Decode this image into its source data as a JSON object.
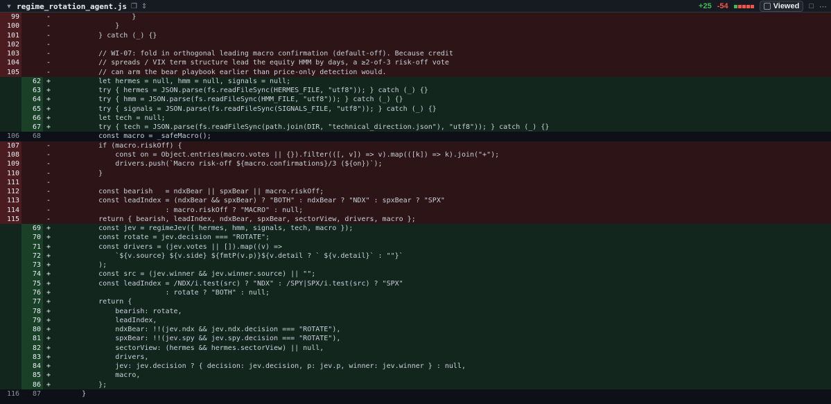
{
  "file": {
    "name": "regime_rotation_agent.js",
    "additions": "+25",
    "deletions": "-54",
    "viewed_label": "Viewed",
    "colors": {
      "add": "#3fb950",
      "del": "#f85149",
      "bg": "#0d1117"
    }
  },
  "lines": [
    {
      "t": "del",
      "o": "99",
      "n": "",
      "m": "-",
      "c": "                }"
    },
    {
      "t": "del",
      "o": "100",
      "n": "",
      "m": "-",
      "c": "            }"
    },
    {
      "t": "del",
      "o": "101",
      "n": "",
      "m": "-",
      "c": "        } catch (_) {}"
    },
    {
      "t": "del",
      "o": "102",
      "n": "",
      "m": "-",
      "c": ""
    },
    {
      "t": "del",
      "o": "103",
      "n": "",
      "m": "-",
      "c": "        // WI-07: fold in orthogonal leading macro confirmation (default-off). Because credit"
    },
    {
      "t": "del",
      "o": "104",
      "n": "",
      "m": "-",
      "c": "        // spreads / VIX term structure lead the equity HMM by days, a ≥2-of-3 risk-off vote"
    },
    {
      "t": "del",
      "o": "105",
      "n": "",
      "m": "-",
      "c": "        // can arm the bear playbook earlier than price-only detection would."
    },
    {
      "t": "add",
      "o": "",
      "n": "62",
      "m": "+",
      "c": "        let hermes = null, hmm = null, signals = null;"
    },
    {
      "t": "add",
      "o": "",
      "n": "63",
      "m": "+",
      "c": "        try { hermes = JSON.parse(fs.readFileSync(HERMES_FILE, \"utf8\")); } catch (_) {}"
    },
    {
      "t": "add",
      "o": "",
      "n": "64",
      "m": "+",
      "c": "        try { hmm = JSON.parse(fs.readFileSync(HMM_FILE, \"utf8\")); } catch (_) {}"
    },
    {
      "t": "add",
      "o": "",
      "n": "65",
      "m": "+",
      "c": "        try { signals = JSON.parse(fs.readFileSync(SIGNALS_FILE, \"utf8\")); } catch (_) {}"
    },
    {
      "t": "add",
      "o": "",
      "n": "66",
      "m": "+",
      "c": "        let tech = null;"
    },
    {
      "t": "add",
      "o": "",
      "n": "67",
      "m": "+",
      "c": "        try { tech = JSON.parse(fs.readFileSync(path.join(DIR, \"technical_direction.json\"), \"utf8\")); } catch (_) {}"
    },
    {
      "t": "ctx",
      "o": "106",
      "n": "68",
      "m": "",
      "c": "        const macro = _safeMacro();"
    },
    {
      "t": "del",
      "o": "107",
      "n": "",
      "m": "-",
      "c": "        if (macro.riskOff) {"
    },
    {
      "t": "del",
      "o": "108",
      "n": "",
      "m": "-",
      "c": "            const on = Object.entries(macro.votes || {}).filter(([, v]) => v).map(([k]) => k).join(\"+\");"
    },
    {
      "t": "del",
      "o": "109",
      "n": "",
      "m": "-",
      "c": "            drivers.push(`Macro risk-off ${macro.confirmations}/3 (${on})`);"
    },
    {
      "t": "del",
      "o": "110",
      "n": "",
      "m": "-",
      "c": "        }"
    },
    {
      "t": "del",
      "o": "111",
      "n": "",
      "m": "-",
      "c": ""
    },
    {
      "t": "del",
      "o": "112",
      "n": "",
      "m": "-",
      "c": "        const bearish   = ndxBear || spxBear || macro.riskOff;"
    },
    {
      "t": "del",
      "o": "113",
      "n": "",
      "m": "-",
      "c": "        const leadIndex = (ndxBear && spxBear) ? \"BOTH\" : ndxBear ? \"NDX\" : spxBear ? \"SPX\""
    },
    {
      "t": "del",
      "o": "114",
      "n": "",
      "m": "-",
      "c": "                        : macro.riskOff ? \"MACRO\" : null;"
    },
    {
      "t": "del",
      "o": "115",
      "n": "",
      "m": "-",
      "c": "        return { bearish, leadIndex, ndxBear, spxBear, sectorView, drivers, macro };"
    },
    {
      "t": "add",
      "o": "",
      "n": "69",
      "m": "+",
      "c": "        const jev = regimeJev({ hermes, hmm, signals, tech, macro });"
    },
    {
      "t": "add",
      "o": "",
      "n": "70",
      "m": "+",
      "c": "        const rotate = jev.decision === \"ROTATE\";"
    },
    {
      "t": "add",
      "o": "",
      "n": "71",
      "m": "+",
      "c": "        const drivers = (jev.votes || []).map((v) =>"
    },
    {
      "t": "add",
      "o": "",
      "n": "72",
      "m": "+",
      "c": "            `${v.source} ${v.side} ${fmtP(v.p)}${v.detail ? ` ${v.detail}` : \"\"}`"
    },
    {
      "t": "add",
      "o": "",
      "n": "73",
      "m": "+",
      "c": "        );"
    },
    {
      "t": "add",
      "o": "",
      "n": "74",
      "m": "+",
      "c": "        const src = (jev.winner && jev.winner.source) || \"\";"
    },
    {
      "t": "add",
      "o": "",
      "n": "75",
      "m": "+",
      "c": "        const leadIndex = /NDX/i.test(src) ? \"NDX\" : /SPY|SPX/i.test(src) ? \"SPX\""
    },
    {
      "t": "add",
      "o": "",
      "n": "76",
      "m": "+",
      "c": "                        : rotate ? \"BOTH\" : null;"
    },
    {
      "t": "add",
      "o": "",
      "n": "77",
      "m": "+",
      "c": "        return {"
    },
    {
      "t": "add",
      "o": "",
      "n": "78",
      "m": "+",
      "c": "            bearish: rotate,"
    },
    {
      "t": "add",
      "o": "",
      "n": "79",
      "m": "+",
      "c": "            leadIndex,"
    },
    {
      "t": "add",
      "o": "",
      "n": "80",
      "m": "+",
      "c": "            ndxBear: !!(jev.ndx && jev.ndx.decision === \"ROTATE\"),"
    },
    {
      "t": "add",
      "o": "",
      "n": "81",
      "m": "+",
      "c": "            spxBear: !!(jev.spy && jev.spy.decision === \"ROTATE\"),"
    },
    {
      "t": "add",
      "o": "",
      "n": "82",
      "m": "+",
      "c": "            sectorView: (hermes && hermes.sectorView) || null,"
    },
    {
      "t": "add",
      "o": "",
      "n": "83",
      "m": "+",
      "c": "            drivers,"
    },
    {
      "t": "add",
      "o": "",
      "n": "84",
      "m": "+",
      "c": "            jev: jev.decision ? { decision: jev.decision, p: jev.p, winner: jev.winner } : null,"
    },
    {
      "t": "add",
      "o": "",
      "n": "85",
      "m": "+",
      "c": "            macro,"
    },
    {
      "t": "add",
      "o": "",
      "n": "86",
      "m": "+",
      "c": "        };"
    },
    {
      "t": "ctx",
      "o": "116",
      "n": "87",
      "m": "",
      "c": "    }"
    }
  ]
}
